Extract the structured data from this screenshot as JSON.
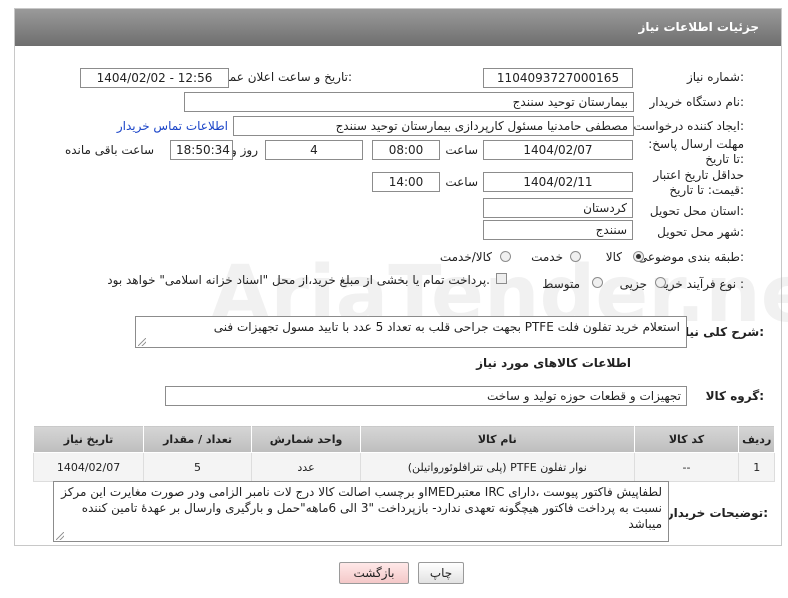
{
  "header": {
    "title": "جزئیات اطلاعات نیاز"
  },
  "fields": {
    "need_number_label": "شماره نیاز:",
    "need_number": "1104093727000165",
    "announce_label": "تاریخ و ساعت اعلان عمومی:",
    "announce_value": "1404/02/02 - 12:56",
    "buyer_org_label": "نام دستگاه خریدار:",
    "buyer_org": "بیمارستان توحید سنندج",
    "requester_label": "ایجاد کننده درخواست:",
    "requester": "مصطفی حامدنیا مسئول کارپردازی بیمارستان توحید سنندج",
    "buyer_contact_link": "اطلاعات تماس خریدار",
    "reply_deadline_label": "مهلت ارسال پاسخ: تا تاریخ:",
    "reply_date": "1404/02/07",
    "time_label": "ساعت",
    "reply_time": "08:00",
    "days_value": "4",
    "days_label": "روز و",
    "remaining_time": "18:50:34",
    "remaining_label": "ساعت باقی مانده",
    "price_validity_label": "حداقل تاریخ اعتبار قیمت: تا تاریخ:",
    "price_date": "1404/02/11",
    "price_time": "14:00",
    "province_label": "استان محل تحویل:",
    "province": "کردستان",
    "city_label": "شهر محل تحویل:",
    "city": "سنندج",
    "category_label": "طبقه بندی موضوعی:",
    "category_options": [
      "کالا",
      "خدمت",
      "کالا/خدمت"
    ],
    "process_label": "نوع فرآیند خرید :",
    "process_options": [
      "جزیی",
      "متوسط"
    ],
    "treasury_text": "پرداخت تمام یا بخشی از مبلغ خرید،از محل \"اسناد خزانه اسلامی\" خواهد بود.",
    "description_label": "شرح کلی نیاز:",
    "description": "استعلام خرید تفلون فلت PTFE بجهت جراحی قلب به  تعداد 5 عدد با تایید مسول تجهیزات فنی"
  },
  "goods": {
    "section_title": "اطلاعات کالاهای مورد نیاز",
    "group_label": "گروه کالا:",
    "group_value": "تجهیزات و قطعات حوزه تولید و ساخت",
    "columns": [
      "ردیف",
      "کد کالا",
      "نام کالا",
      "واحد شمارش",
      "تعداد / مقدار",
      "تاریخ نیاز"
    ],
    "rows": [
      [
        "1",
        "--",
        "نوار تفلون PTFE (پلی تترافلوئورواتیلن)",
        "عدد",
        "5",
        "1404/02/07"
      ]
    ]
  },
  "buyer_notes": {
    "label": "توضیحات خریدار:",
    "text": "لطفاپیش فاکتور پیوست ،دارای IRC معتبرIMEDو برچسب اصالت کالا درج لات نامبر الزامی ودر صورت مغایرت این مرکز نسبت به پرداخت فاکتور هیچگونه تعهدی ندارد- بازپرداخت \"3 الی 6ماهه\"حمل و بارگیری وارسال بر عهدهٔ تامین کننده میباشد"
  },
  "buttons": {
    "print": "چاپ",
    "back": "بازگشت"
  },
  "watermark": "AriaTender.neT"
}
